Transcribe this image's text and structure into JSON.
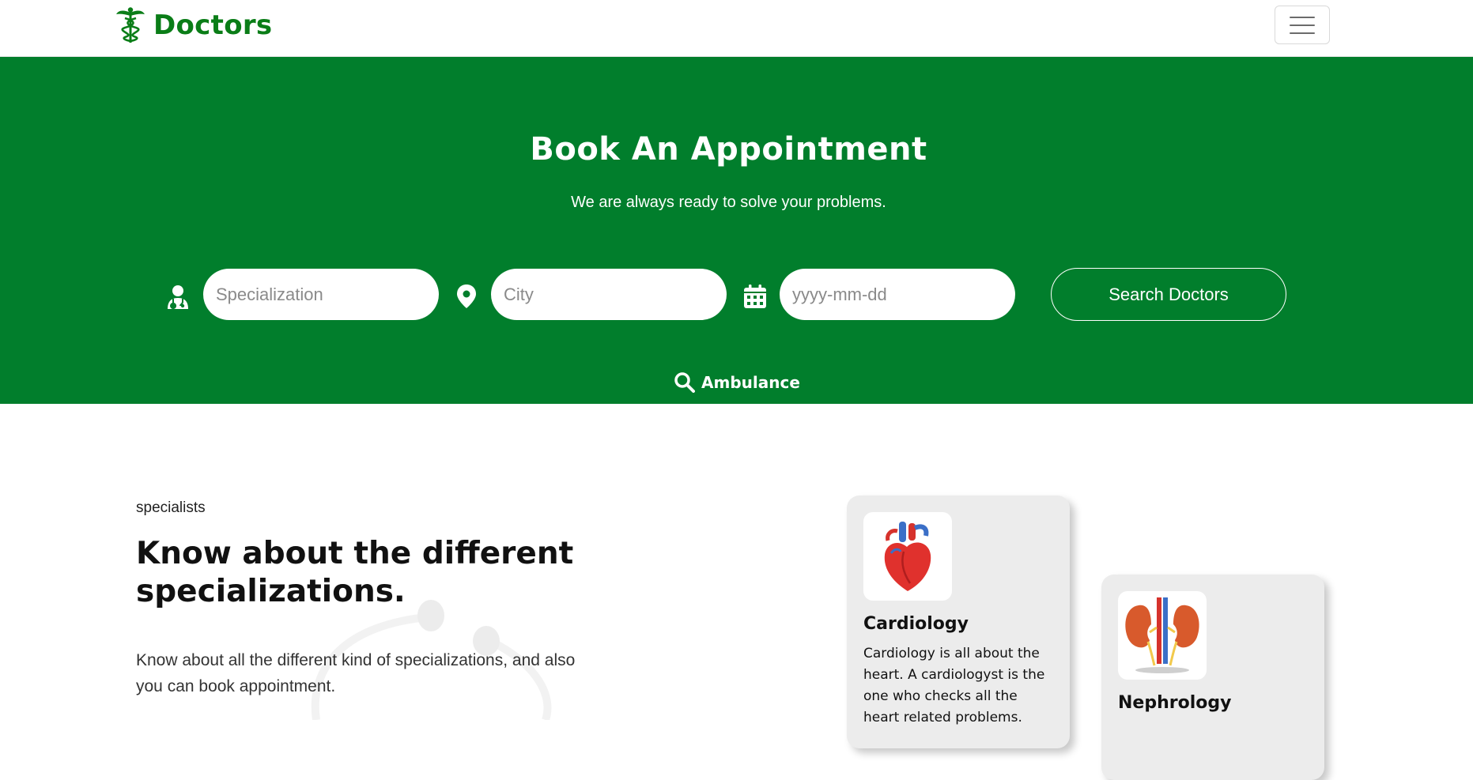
{
  "navbar": {
    "brand": "Doctors",
    "brand_icon": "caduceus-icon",
    "menu_icon": "hamburger-menu-icon"
  },
  "hero": {
    "title": "Book An Appointment",
    "subtitle": "We are always ready to solve your problems.",
    "specialization": {
      "placeholder": "Specialization",
      "value": "",
      "icon": "doctor-icon"
    },
    "city": {
      "placeholder": "City",
      "value": "",
      "icon": "location-pin-icon"
    },
    "date": {
      "placeholder": "yyyy-mm-dd",
      "value": "",
      "icon": "calendar-icon"
    },
    "search_button": "Search Doctors",
    "ambulance": {
      "label": "Ambulance",
      "icon": "search-icon"
    }
  },
  "specialists": {
    "eyebrow": "specialists",
    "title": "Know about the different specializations.",
    "body": "Know about all the different kind of specializations, and also you can book appointment.",
    "cards": [
      {
        "title": "Cardiology",
        "text": "Cardiology is all about the heart. A cardiologyst is the one who checks all the heart related problems.",
        "icon": "heart-icon"
      },
      {
        "title": "Nephrology",
        "text": "",
        "icon": "kidney-icon"
      }
    ]
  },
  "colors": {
    "brand_green": "#0a7d17",
    "hero_green": "#017e2c",
    "card_bg": "#ececec"
  }
}
